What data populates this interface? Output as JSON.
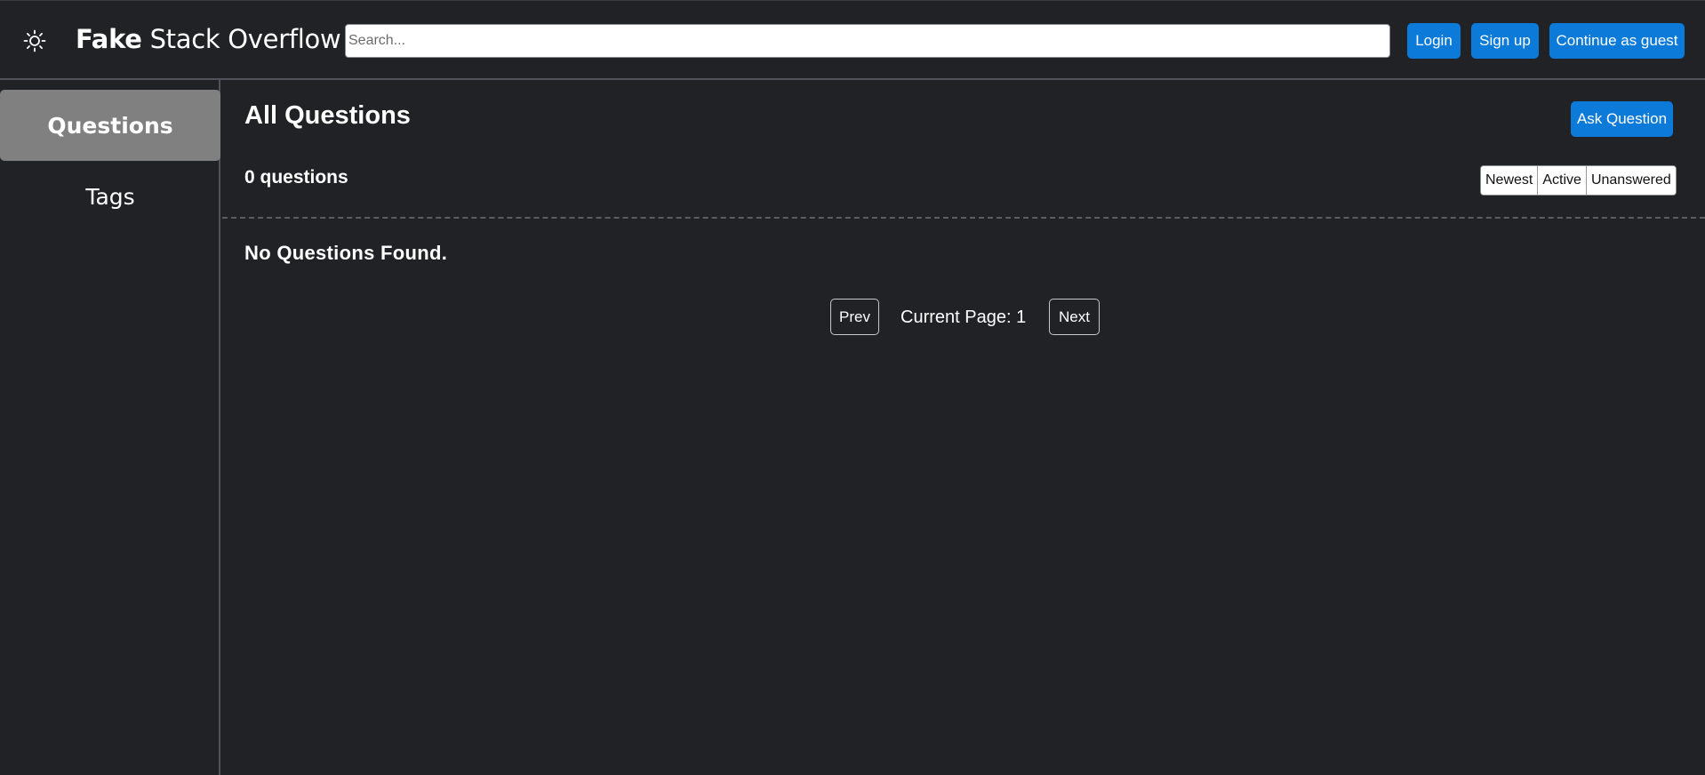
{
  "header": {
    "theme_icon": "sun-icon",
    "brand_bold": "Fake",
    "brand_rest": " Stack Overflow",
    "search_placeholder": "Search...",
    "search_value": "",
    "login_label": "Login",
    "signup_label": "Sign up",
    "guest_label": "Continue as guest"
  },
  "sidebar": {
    "items": [
      {
        "label": "Questions",
        "active": true
      },
      {
        "label": "Tags",
        "active": false
      }
    ]
  },
  "main": {
    "title": "All Questions",
    "ask_label": "Ask Question",
    "count_text": "0 questions",
    "sort_options": [
      "Newest",
      "Active",
      "Unanswered"
    ],
    "empty_message": "No Questions Found.",
    "pagination": {
      "prev_label": "Prev",
      "current_text": "Current Page: 1",
      "next_label": "Next"
    }
  },
  "colors": {
    "background": "#202226",
    "accent": "#0b7ad9",
    "sidebar_active": "#808080",
    "border": "#50545a"
  }
}
